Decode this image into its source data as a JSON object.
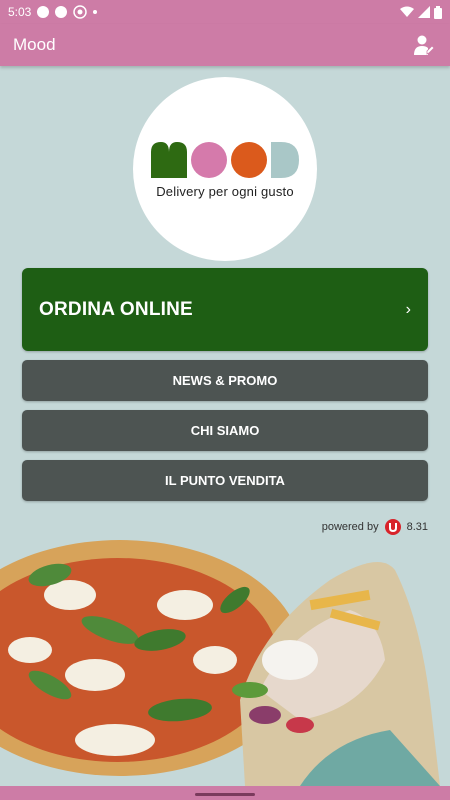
{
  "status_bar": {
    "time": "5:03"
  },
  "app_bar": {
    "title": "Mood",
    "profile_icon": "user-icon"
  },
  "logo": {
    "word": "MOOD",
    "tagline": "Delivery per ogni gusto"
  },
  "buttons": {
    "order": {
      "label": "ORDINA ONLINE",
      "chevron": "›"
    },
    "news": "NEWS & PROMO",
    "about": "CHI SIAMO",
    "store": "IL PUNTO VENDITA"
  },
  "footer": {
    "powered_by": "powered by",
    "version": "8.31"
  },
  "colors": {
    "brand_pink": "#cd7ca6",
    "order_green": "#1e5e14",
    "button_grey": "#4d5452",
    "background": "#c5d8d8"
  }
}
